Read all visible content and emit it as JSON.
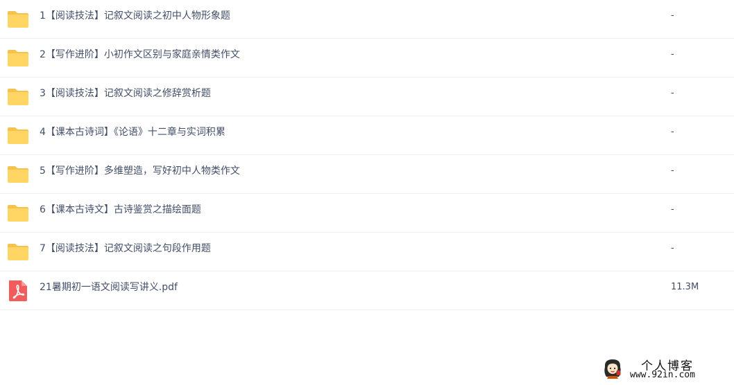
{
  "files": [
    {
      "name": "1【阅读技法】记叙文阅读之初中人物形象题",
      "size": "-",
      "type": "folder"
    },
    {
      "name": "2【写作进阶】小初作文区别与家庭亲情类作文",
      "size": "-",
      "type": "folder"
    },
    {
      "name": "3【阅读技法】记叙文阅读之修辞赏析题",
      "size": "-",
      "type": "folder"
    },
    {
      "name": "4【课本古诗词】《论语》十二章与实词积累",
      "size": "-",
      "type": "folder"
    },
    {
      "name": "5【写作进阶】多维塑造，写好初中人物类作文",
      "size": "-",
      "type": "folder"
    },
    {
      "name": "6【课本古诗文】古诗鉴赏之描绘面题",
      "size": "-",
      "type": "folder"
    },
    {
      "name": "7【阅读技法】记叙文阅读之句段作用题",
      "size": "-",
      "type": "folder"
    },
    {
      "name": "21暑期初一语文阅读写讲义.pdf",
      "size": "11.3M",
      "type": "pdf"
    }
  ],
  "icons": {
    "folder": "folder-icon",
    "pdf": "pdf-file-icon"
  },
  "colors": {
    "folder": "#ffd664",
    "folder_tab": "#f5c24c",
    "pdf": "#f25c5c",
    "text": "#424e67",
    "divider": "#eef0f4"
  },
  "watermark": {
    "title": "个人博客",
    "url": "www.92in.com"
  }
}
